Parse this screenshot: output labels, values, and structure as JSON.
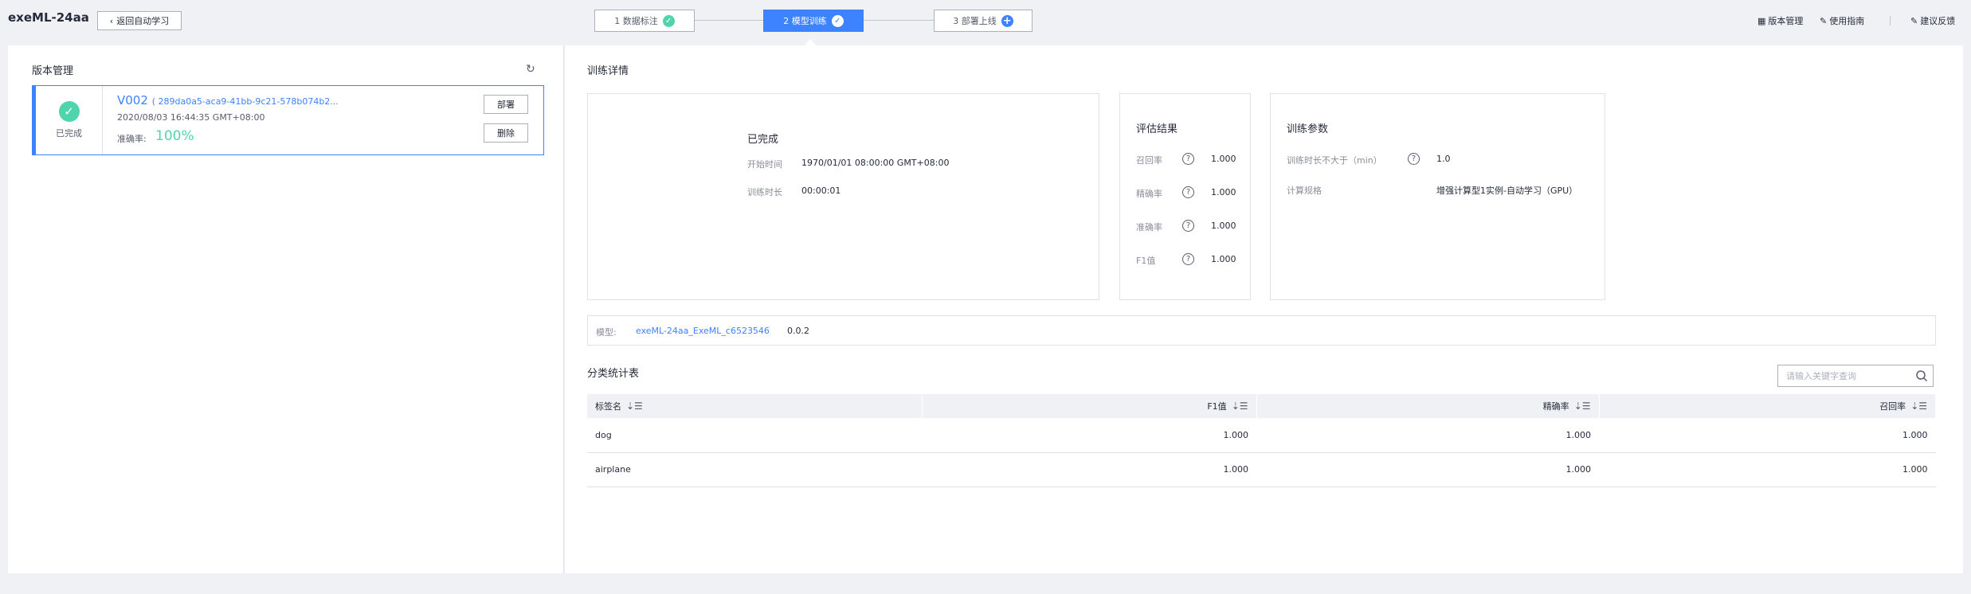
{
  "header": {
    "app_title": "exeML-24aa",
    "back_label": "返回自动学习",
    "steps": [
      {
        "label": "1 数据标注",
        "status": "done"
      },
      {
        "label": "2 模型训练",
        "status": "active"
      },
      {
        "label": "3 部署上线",
        "status": "pending"
      }
    ],
    "links": {
      "version_mgmt": "版本管理",
      "guide": "使用指南",
      "feedback": "建议反馈"
    }
  },
  "version_panel": {
    "title": "版本管理",
    "card": {
      "status_label": "已完成",
      "version": "V002",
      "hash": "( 289da0a5-aca9-41bb-9c21-578b074b2...",
      "date": "2020/08/03 16:44:35 GMT+08:00",
      "accuracy_label": "准确率:",
      "accuracy": "100%",
      "deploy_label": "部署",
      "delete_label": "删除"
    }
  },
  "details": {
    "title": "训练详情",
    "status": {
      "heading": "已完成",
      "start_label": "开始时间",
      "start_value": "1970/01/01 08:00:00 GMT+08:00",
      "duration_label": "训练时长",
      "duration_value": "00:00:01"
    },
    "eval": {
      "title": "评估结果",
      "rows": [
        {
          "label": "召回率",
          "value": "1.000"
        },
        {
          "label": "精确率",
          "value": "1.000"
        },
        {
          "label": "准确率",
          "value": "1.000"
        },
        {
          "label": "F1值",
          "value": "1.000"
        }
      ]
    },
    "params": {
      "title": "训练参数",
      "duration_limit_label": "训练时长不大于（min）",
      "duration_limit_value": "1.0",
      "spec_label": "计算规格",
      "spec_value": "增强计算型1实例-自动学习（GPU）"
    },
    "model": {
      "label": "模型:",
      "name": "exeML-24aa_ExeML_c6523546",
      "version": "0.0.2"
    }
  },
  "class_stats": {
    "title": "分类统计表",
    "search_placeholder": "请输入关键字查询",
    "columns": [
      "标签名",
      "F1值",
      "精确率",
      "召回率"
    ],
    "rows": [
      [
        "dog",
        "1.000",
        "1.000",
        "1.000"
      ],
      [
        "airplane",
        "1.000",
        "1.000",
        "1.000"
      ]
    ]
  },
  "colors": {
    "accent": "#3d82ff",
    "success": "#50d4ab",
    "bg": "#f0f1f5"
  }
}
